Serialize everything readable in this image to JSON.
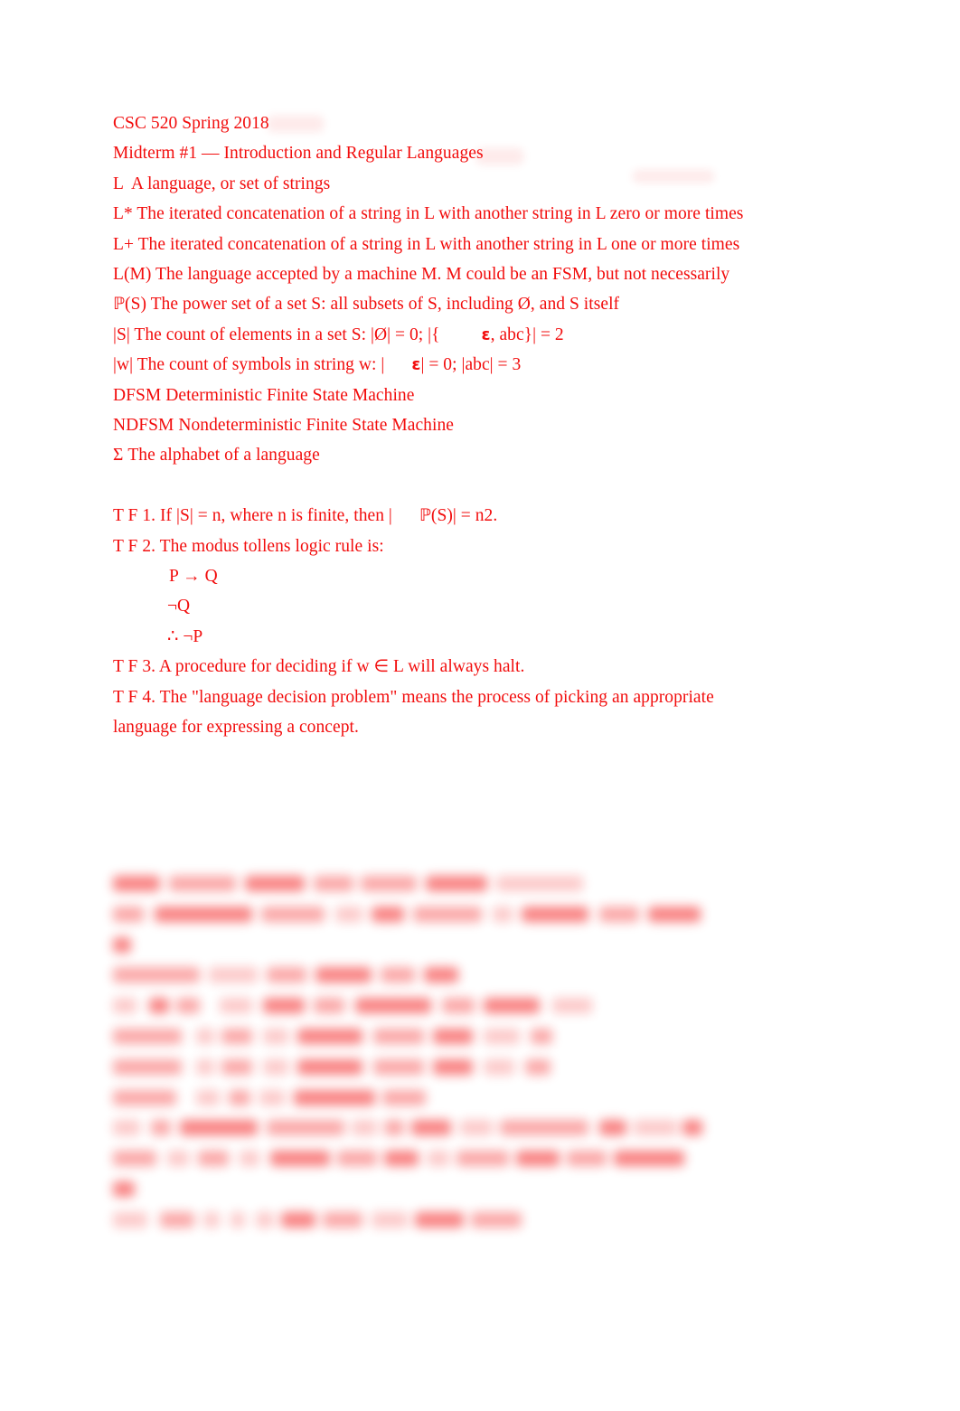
{
  "document": {
    "title": "CSC 520 Spring 2018",
    "subtitle": "Midterm #1 — Introduction and Regular Languages",
    "text_color": "#f20d0d",
    "background_color": "#ffffff"
  },
  "definitions": [
    {
      "term": "L",
      "line": "L  A language, or set of strings"
    },
    {
      "term": "L*",
      "line": "L* The iterated concatenation of a string in L with another string in L zero or more times"
    },
    {
      "term": "L+",
      "line": "L+ The iterated concatenation of a string in L with another string in L one or more times"
    },
    {
      "term": "L(M)",
      "line": "L(M) The language accepted by a machine M. M could be an FSM, but not necessarily"
    },
    {
      "term": "P(S)",
      "prefix": "ℙ",
      "line": "(S) The power set of a set S: all subsets of S, including Ø, and S itself"
    },
    {
      "term": "|S|",
      "part_a": "|S| The count of elements in a set S: |Ø| = 0; |{",
      "eps": "ε",
      "part_b": ", abc}| = 2"
    },
    {
      "term": "|w|",
      "part_a": "|w| The count of symbols in string w: |",
      "eps": "ε",
      "part_b": "| = 0; |abc| = 3"
    },
    {
      "term": "DFSM",
      "line": "DFSM Deterministic Finite State Machine"
    },
    {
      "term": "NDFSM",
      "line": "NDFSM Nondeterministic Finite State Machine"
    },
    {
      "term": "Sigma",
      "line": "Σ The alphabet of a language"
    }
  ],
  "questions": [
    {
      "id": "1",
      "marker": "T F 1.",
      "part_a": "T F 1. If |S| = n, where n is finite, then |",
      "symbol": "ℙ",
      "part_b": "(S)| = n2."
    },
    {
      "id": "2",
      "marker": "T F 2.",
      "text": "T F 2. The modus tollens logic rule is:",
      "rule_lines": [
        "P → Q",
        "¬Q",
        "∴ ¬P"
      ]
    },
    {
      "id": "3",
      "marker": "T F 3.",
      "part_a": "T F 3. A procedure for deciding if w ",
      "symbol": "∈",
      "part_b": " L will always halt."
    },
    {
      "id": "4",
      "marker": "T F 4.",
      "line_1": "T F 4. The \"language decision problem\" means the process of picking an appropriate",
      "line_2": "language for expressing a concept."
    }
  ],
  "redacted_section": {
    "legible": false,
    "note": "blurred / obscured text block",
    "line_count": 11
  }
}
